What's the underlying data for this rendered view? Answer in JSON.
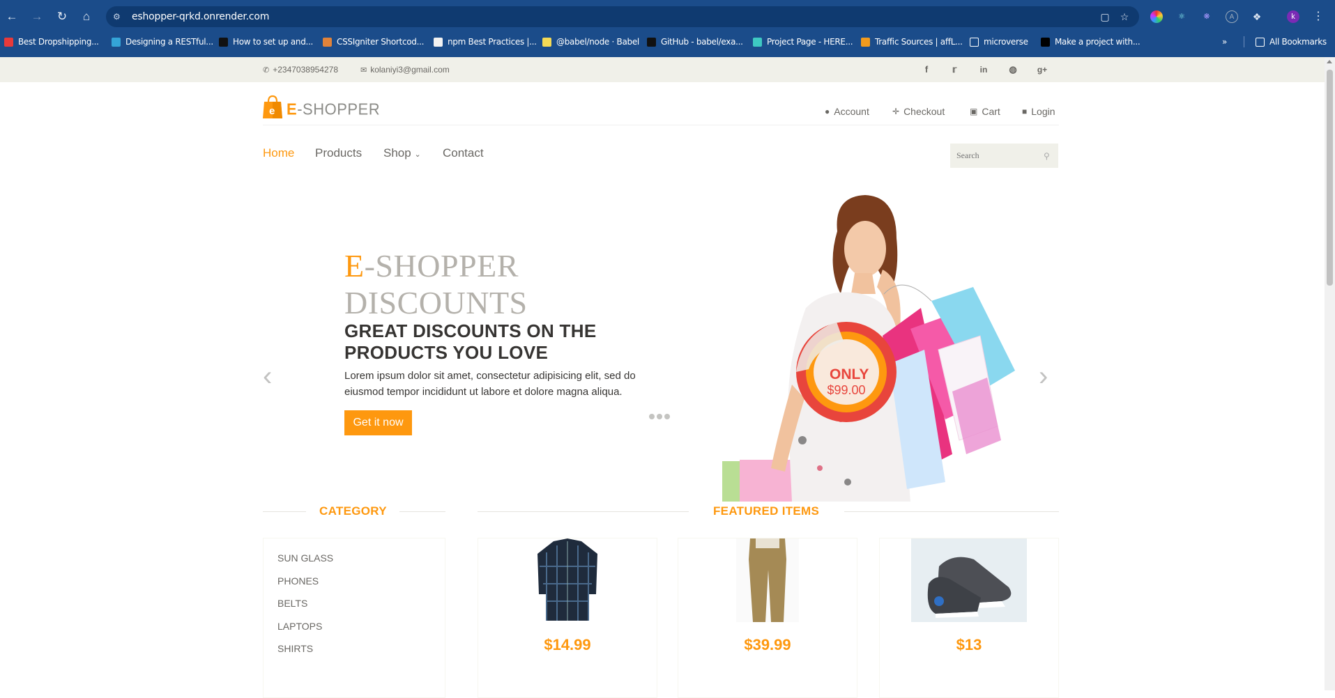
{
  "browser": {
    "url": "eshopper-qrkd.onrender.com",
    "profile_initial": "k",
    "bookmarks": [
      {
        "label": "Best Dropshipping...",
        "color": "#e83a3a"
      },
      {
        "label": "Designing a RESTful...",
        "color": "#34a4d8"
      },
      {
        "label": "How to set up and...",
        "color": "#111111"
      },
      {
        "label": "CSSIgniter Shortcod...",
        "color": "#e1833a"
      },
      {
        "label": "npm Best Practices |...",
        "color": "#f2f2f2"
      },
      {
        "label": "@babel/node · Babel",
        "color": "#f5da55"
      },
      {
        "label": "GitHub - babel/exa...",
        "color": "#111111"
      },
      {
        "label": "Project Page - HERE...",
        "color": "#3ec9c2"
      },
      {
        "label": "Traffic Sources | affL...",
        "color": "#f29b1d"
      },
      {
        "label": "microverse",
        "color": "folder"
      },
      {
        "label": "Make a project with...",
        "color": "#000000"
      }
    ],
    "all_bookmarks_label": "All Bookmarks"
  },
  "topbar": {
    "phone": "+2347038954278",
    "email": "kolaniyi3@gmail.com",
    "social_icons": [
      "facebook-icon",
      "twitter-icon",
      "linkedin-icon",
      "dribbble-icon",
      "google-plus-icon"
    ]
  },
  "header": {
    "logo_e": "E",
    "logo_rest": "-SHOPPER",
    "account_links": [
      {
        "label": "Account",
        "icon": "user-icon"
      },
      {
        "label": "Checkout",
        "icon": "crosshairs-icon"
      },
      {
        "label": "Cart",
        "icon": "cart-icon"
      },
      {
        "label": "Login",
        "icon": "lock-icon"
      }
    ]
  },
  "nav": {
    "items": [
      "Home",
      "Products",
      "Shop",
      "Contact"
    ],
    "active": "Home",
    "search_placeholder": "Search"
  },
  "slider": {
    "title_e": "E",
    "title_line1_rest": "-SHOPPER",
    "title_line2": "DISCOUNTS",
    "subtitle": "GREAT DISCOUNTS ON THE PRODUCTS YOU LOVE",
    "description": "Lorem ipsum dolor sit amet, consectetur adipisicing elit, sed do eiusmod tempor incididunt ut labore et dolore magna aliqua.",
    "cta_label": "Get it now",
    "badge_top": "ONLY",
    "badge_price": "$99.00"
  },
  "category": {
    "title": "CATEGORY",
    "items": [
      "SUN GLASS",
      "PHONES",
      "BELTS",
      "LAPTOPS",
      "SHIRTS"
    ]
  },
  "featured": {
    "title": "FEATURED ITEMS",
    "items": [
      {
        "price": "$14.99",
        "image": "plaid-shirt"
      },
      {
        "price": "$39.99",
        "image": "khaki-pants"
      },
      {
        "price": "$13",
        "image": "sneakers"
      }
    ]
  },
  "colors": {
    "accent": "#fe980f",
    "browser_bar": "#1b4c8a",
    "topbar_bg": "#f0f0e9"
  }
}
